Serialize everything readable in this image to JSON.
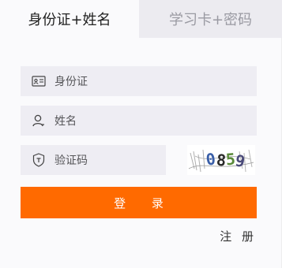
{
  "tabs": {
    "active_label": "身份证+姓名",
    "inactive_label": "学习卡+密码"
  },
  "form": {
    "id_placeholder": "身份证",
    "name_placeholder": "姓名",
    "code_placeholder": "验证码",
    "captcha_text": "0859"
  },
  "actions": {
    "login_label": "登 录",
    "register_label": "注 册"
  },
  "colors": {
    "accent": "#ff6a00",
    "field_bg": "#eeedf3",
    "inactive_tab_bg": "#ecebf0"
  },
  "icons": {
    "id_field": "id-card-icon",
    "name_field": "user-icon",
    "code_field": "shield-icon"
  }
}
